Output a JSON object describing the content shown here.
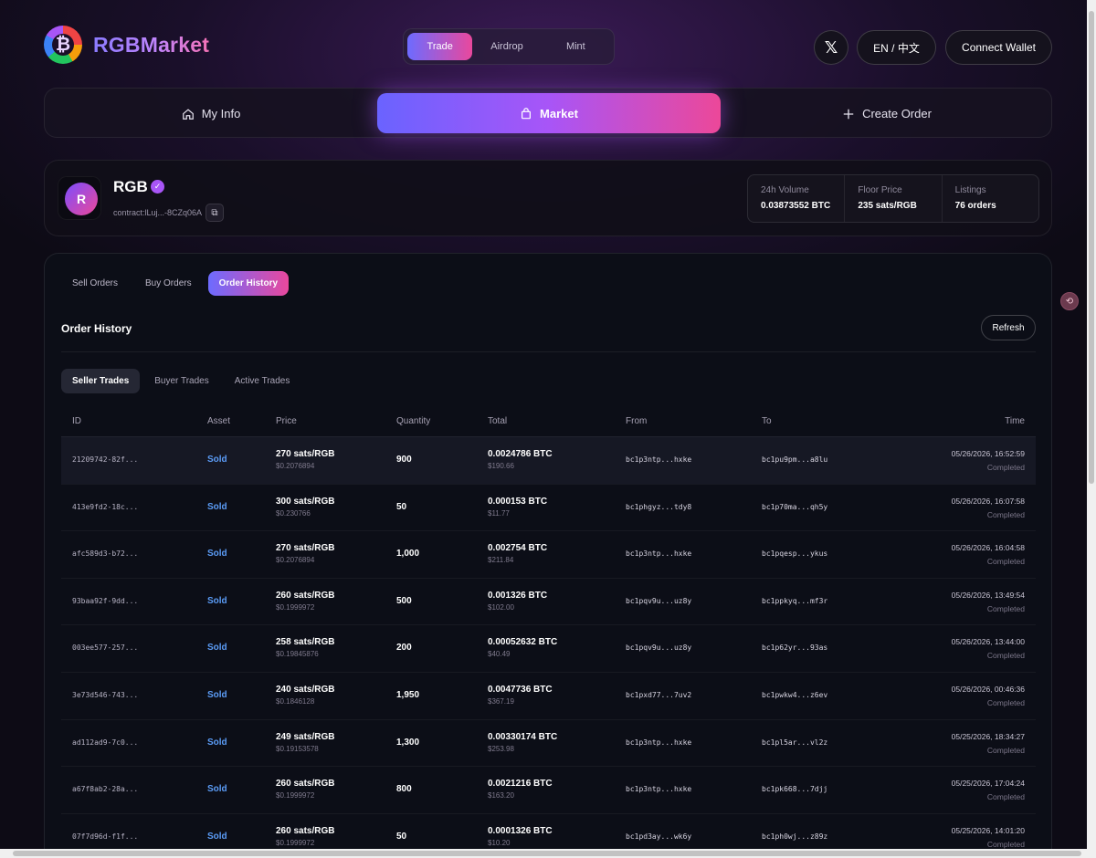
{
  "header": {
    "logo_glyph": "₿",
    "brand": "RGBMarket",
    "modes": [
      "Trade",
      "Airdrop",
      "Mint"
    ],
    "twitter_icon": "x-logo-icon",
    "twitter_glyph": "𝕏",
    "lang": "EN / 中文",
    "wallet": "Connect Wallet"
  },
  "main_tabs": {
    "my_info": "My Info",
    "market": "Market",
    "create_order": "Create Order"
  },
  "token": {
    "avatar": "R",
    "name": "RGB",
    "verified_glyph": "✓",
    "contract": "contract:lLuj...-8CZq06A",
    "copy_glyph": "⧉",
    "stats": [
      {
        "label": "24h Volume",
        "value": "0.03873552 BTC"
      },
      {
        "label": "Floor Price",
        "value": "235 sats/RGB"
      },
      {
        "label": "Listings",
        "value": "76 orders"
      }
    ]
  },
  "orders": {
    "tabs": [
      "Sell Orders",
      "Buy Orders",
      "Order History"
    ],
    "title": "Order History",
    "refresh": "Refresh",
    "trade_tabs": [
      "Seller Trades",
      "Buyer Trades",
      "Active Trades"
    ],
    "columns": [
      "ID",
      "Asset",
      "Price",
      "Quantity",
      "Total",
      "From",
      "To",
      "Time"
    ],
    "rows": [
      {
        "id": "21209742-82f...",
        "asset": "Sold",
        "price": "270 sats/RGB",
        "price_usd": "$0.2076894",
        "qty": "900",
        "total": "0.0024786 BTC",
        "total_usd": "$190.66",
        "from": "bc1p3ntp...hxke",
        "to": "bc1pu9pm...a8lu",
        "time": "05/26/2026, 16:52:59",
        "status": "Completed"
      },
      {
        "id": "413e9fd2-18c...",
        "asset": "Sold",
        "price": "300 sats/RGB",
        "price_usd": "$0.230766",
        "qty": "50",
        "total": "0.000153 BTC",
        "total_usd": "$11.77",
        "from": "bc1phgyz...tdy8",
        "to": "bc1p70ma...qh5y",
        "time": "05/26/2026, 16:07:58",
        "status": "Completed"
      },
      {
        "id": "afc589d3-b72...",
        "asset": "Sold",
        "price": "270 sats/RGB",
        "price_usd": "$0.2076894",
        "qty": "1,000",
        "total": "0.002754 BTC",
        "total_usd": "$211.84",
        "from": "bc1p3ntp...hxke",
        "to": "bc1pqesp...ykus",
        "time": "05/26/2026, 16:04:58",
        "status": "Completed"
      },
      {
        "id": "93baa92f-9dd...",
        "asset": "Sold",
        "price": "260 sats/RGB",
        "price_usd": "$0.1999972",
        "qty": "500",
        "total": "0.001326 BTC",
        "total_usd": "$102.00",
        "from": "bc1pqv9u...uz8y",
        "to": "bc1ppkyq...mf3r",
        "time": "05/26/2026, 13:49:54",
        "status": "Completed"
      },
      {
        "id": "003ee577-257...",
        "asset": "Sold",
        "price": "258 sats/RGB",
        "price_usd": "$0.19845876",
        "qty": "200",
        "total": "0.00052632 BTC",
        "total_usd": "$40.49",
        "from": "bc1pqv9u...uz8y",
        "to": "bc1p62yr...93as",
        "time": "05/26/2026, 13:44:00",
        "status": "Completed"
      },
      {
        "id": "3e73d546-743...",
        "asset": "Sold",
        "price": "240 sats/RGB",
        "price_usd": "$0.1846128",
        "qty": "1,950",
        "total": "0.0047736 BTC",
        "total_usd": "$367.19",
        "from": "bc1pxd77...7uv2",
        "to": "bc1pwkw4...z6ev",
        "time": "05/26/2026, 00:46:36",
        "status": "Completed"
      },
      {
        "id": "ad112ad9-7c0...",
        "asset": "Sold",
        "price": "249 sats/RGB",
        "price_usd": "$0.19153578",
        "qty": "1,300",
        "total": "0.00330174 BTC",
        "total_usd": "$253.98",
        "from": "bc1p3ntp...hxke",
        "to": "bc1pl5ar...vl2z",
        "time": "05/25/2026, 18:34:27",
        "status": "Completed"
      },
      {
        "id": "a67f8ab2-28a...",
        "asset": "Sold",
        "price": "260 sats/RGB",
        "price_usd": "$0.1999972",
        "qty": "800",
        "total": "0.0021216 BTC",
        "total_usd": "$163.20",
        "from": "bc1p3ntp...hxke",
        "to": "bc1pk668...7djj",
        "time": "05/25/2026, 17:04:24",
        "status": "Completed"
      },
      {
        "id": "07f7d96d-f1f...",
        "asset": "Sold",
        "price": "260 sats/RGB",
        "price_usd": "$0.1999972",
        "qty": "50",
        "total": "0.0001326 BTC",
        "total_usd": "$10.20",
        "from": "bc1pd3ay...wk6y",
        "to": "bc1ph0wj...z89z",
        "time": "05/25/2026, 14:01:20",
        "status": "Completed"
      }
    ]
  },
  "floating_glyph": "⟲"
}
